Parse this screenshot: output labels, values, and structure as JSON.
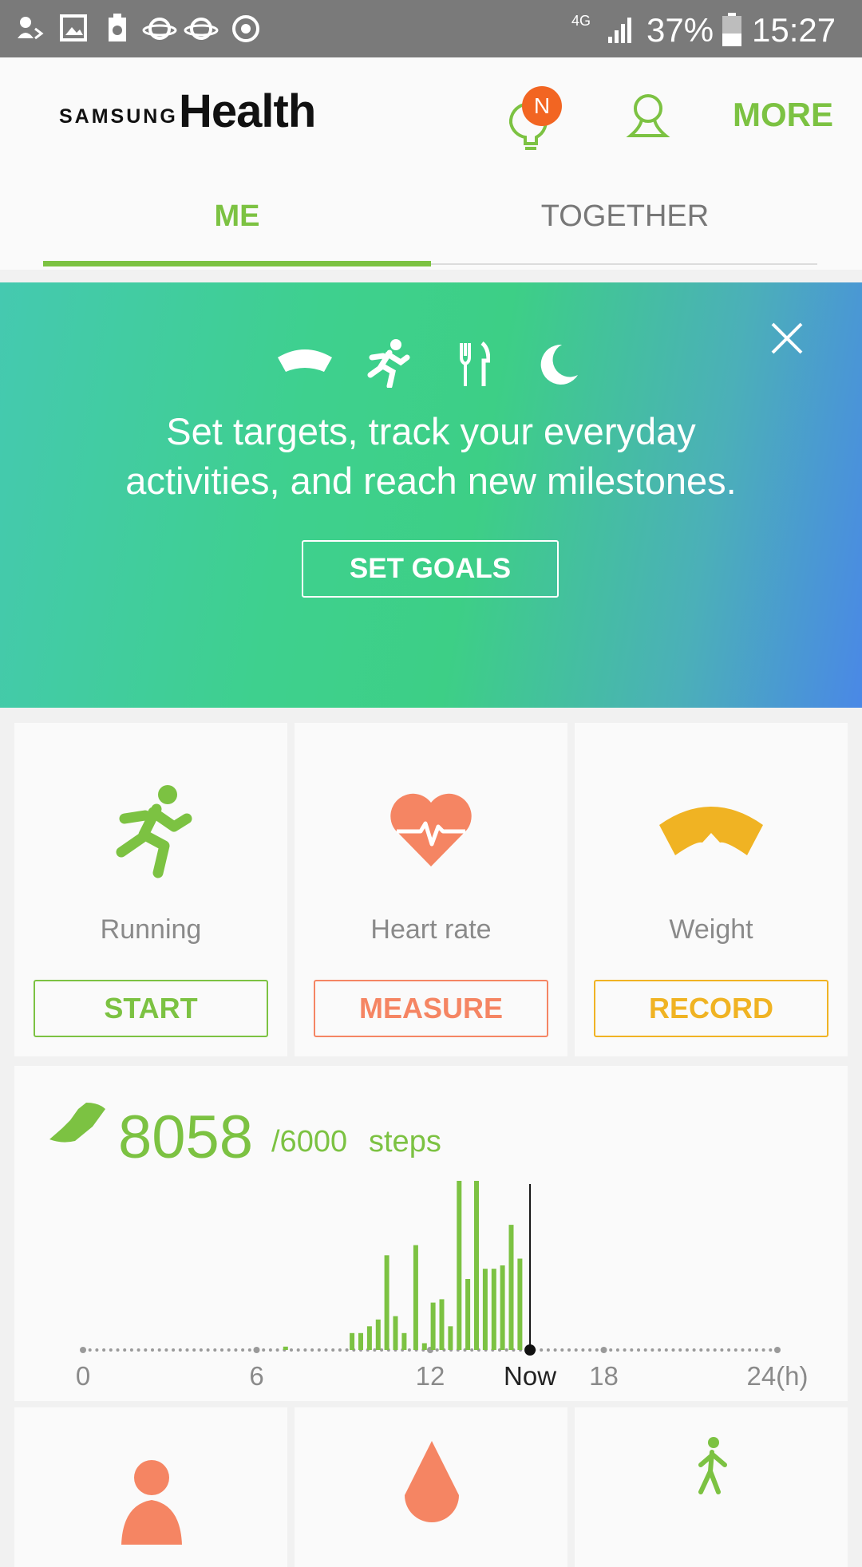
{
  "status_bar": {
    "network": "4G",
    "battery_percent": "37%",
    "time": "15:27"
  },
  "header": {
    "brand_samsung": "SAMSUNG",
    "brand_health": "Health",
    "notification_badge": "N",
    "more_label": "MORE"
  },
  "tabs": [
    {
      "label": "ME",
      "selected": true
    },
    {
      "label": "TOGETHER",
      "selected": false
    }
  ],
  "banner": {
    "message_line1": "Set targets, track your everyday",
    "message_line2": "activities, and reach new milestones.",
    "button_label": "SET GOALS",
    "icons": [
      "weight-scale-icon",
      "running-icon",
      "fork-knife-icon",
      "moon-icon"
    ]
  },
  "trackers": [
    {
      "label": "Running",
      "button": "START",
      "color": "#7cc242",
      "icon": "running-icon"
    },
    {
      "label": "Heart rate",
      "button": "MEASURE",
      "color": "#f58563",
      "icon": "heart-rate-icon"
    },
    {
      "label": "Weight",
      "button": "RECORD",
      "color": "#f0b323",
      "icon": "weight-scale-icon"
    }
  ],
  "steps": {
    "count": "8058",
    "target": "/6000",
    "unit": "steps",
    "accent": "#7cc242"
  },
  "chart_data": {
    "type": "bar",
    "x_ticks": [
      "0",
      "6",
      "12",
      "Now",
      "18",
      "24(h)"
    ],
    "x_tick_hours": [
      0,
      6,
      12,
      15.45,
      18,
      24
    ],
    "now_hour": 15.45,
    "xlim": [
      0,
      24
    ],
    "bars": [
      {
        "hour": 7.0,
        "value": 2
      },
      {
        "hour": 9.3,
        "value": 10
      },
      {
        "hour": 9.6,
        "value": 10
      },
      {
        "hour": 9.9,
        "value": 14
      },
      {
        "hour": 10.2,
        "value": 18
      },
      {
        "hour": 10.5,
        "value": 56
      },
      {
        "hour": 10.8,
        "value": 20
      },
      {
        "hour": 11.1,
        "value": 10
      },
      {
        "hour": 11.5,
        "value": 62
      },
      {
        "hour": 11.8,
        "value": 4
      },
      {
        "hour": 12.1,
        "value": 28
      },
      {
        "hour": 12.4,
        "value": 30
      },
      {
        "hour": 12.7,
        "value": 14
      },
      {
        "hour": 13.0,
        "value": 100
      },
      {
        "hour": 13.3,
        "value": 42
      },
      {
        "hour": 13.6,
        "value": 100
      },
      {
        "hour": 13.9,
        "value": 48
      },
      {
        "hour": 14.2,
        "value": 48
      },
      {
        "hour": 14.5,
        "value": 50
      },
      {
        "hour": 14.8,
        "value": 74
      },
      {
        "hour": 15.1,
        "value": 54
      }
    ]
  }
}
